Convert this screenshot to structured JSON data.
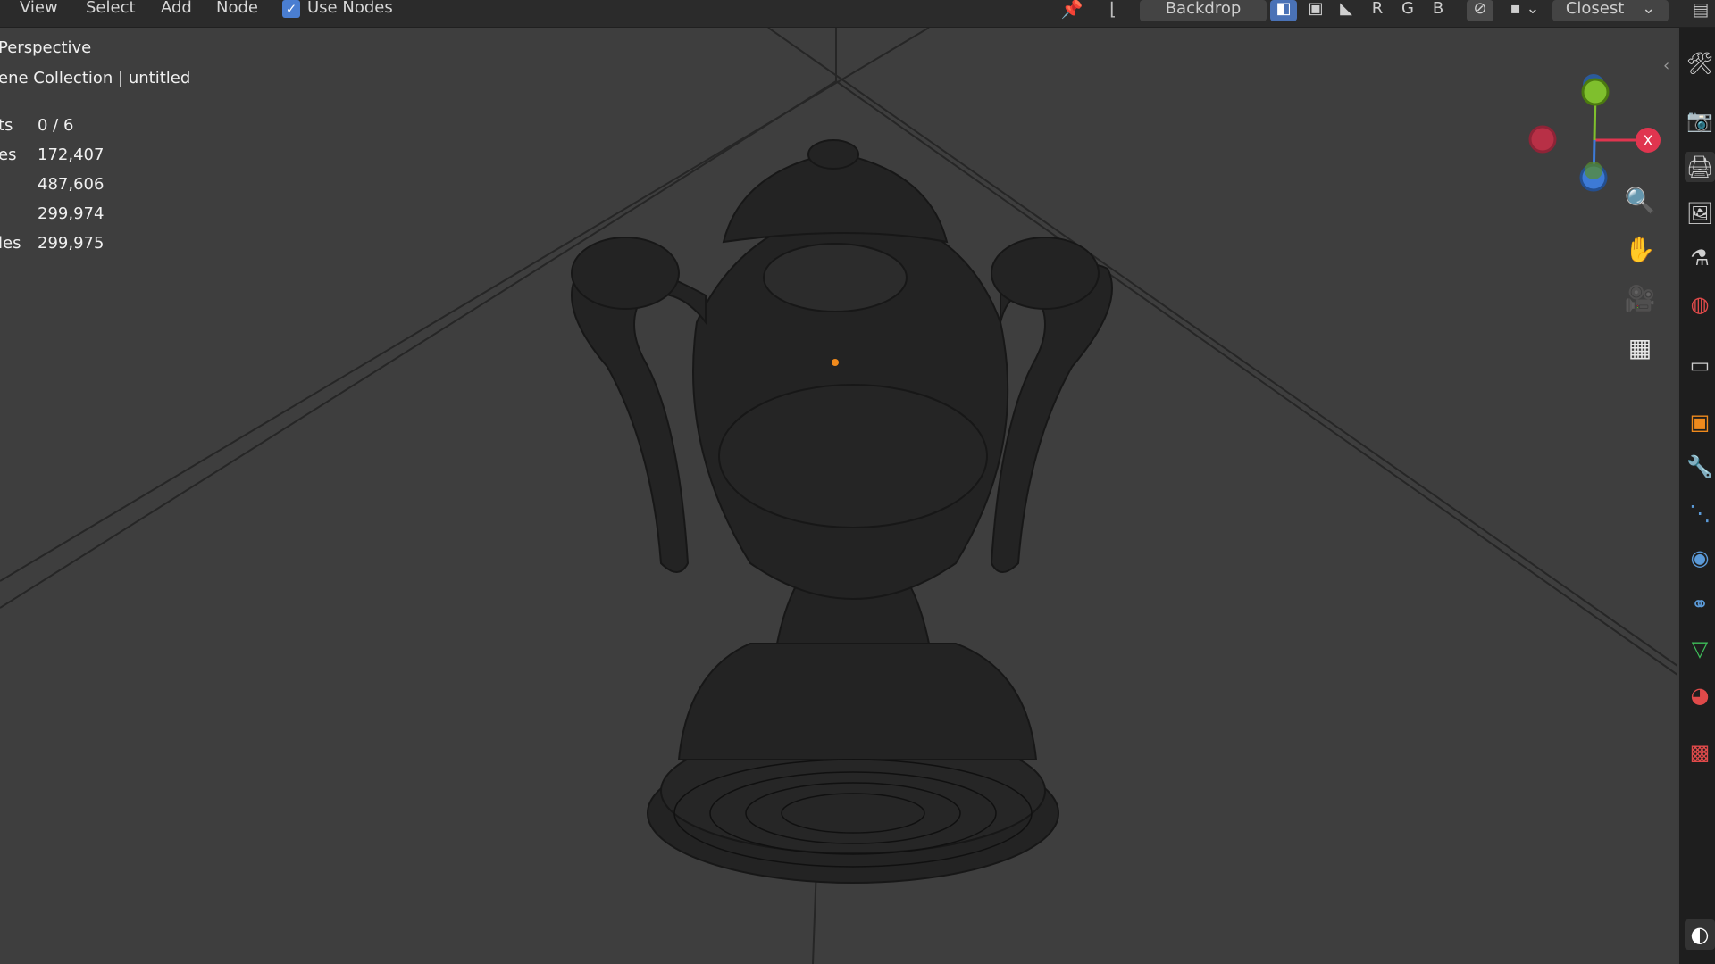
{
  "header": {
    "menu": [
      "View",
      "Select",
      "Add",
      "Node"
    ],
    "use_nodes_label": "Use Nodes",
    "backdrop_label": "Backdrop",
    "channels": [
      "R",
      "G",
      "B"
    ],
    "filter_value": "Closest"
  },
  "viewport": {
    "view_name": "Perspective",
    "collection_path": "ene Collection | untitled",
    "stats": [
      {
        "label": "ts",
        "value": "0 / 6"
      },
      {
        "label": "es",
        "value": "172,407"
      },
      {
        "label": "",
        "value": "487,606"
      },
      {
        "label": "",
        "value": "299,974"
      },
      {
        "label": "les",
        "value": "299,975"
      }
    ]
  },
  "gizmo": {
    "x_label": "X",
    "colors": {
      "x": "#e0354f",
      "y": "#7fbf2d",
      "z": "#3d7ad6"
    }
  },
  "nav_icons": [
    "zoom-icon",
    "hand-pan-icon",
    "camera-icon",
    "grid-ortho-icon"
  ],
  "properties_icons": [
    "tool-icon",
    "render-icon",
    "output-icon",
    "view-layer-icon",
    "scene-icon",
    "world-icon",
    "collection-icon",
    "object-icon",
    "modifier-icon",
    "particles-icon",
    "physics-icon",
    "constraints-icon",
    "data-icon",
    "material-icon",
    "texture-icon"
  ]
}
